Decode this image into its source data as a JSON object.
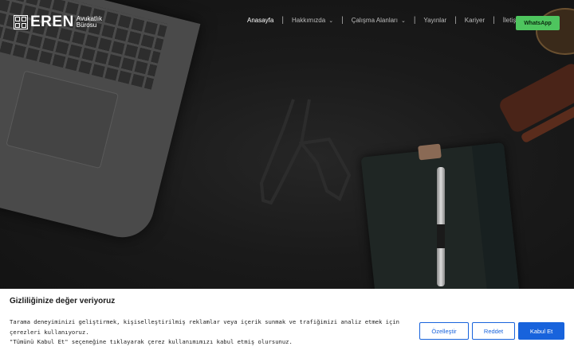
{
  "brand": {
    "name": "EREN",
    "subtitle_line1": "Avukatlık",
    "subtitle_line2": "Bürosu"
  },
  "nav": {
    "items": [
      {
        "label": "Anasayfa",
        "active": true,
        "dropdown": false
      },
      {
        "label": "Hakkımızda",
        "active": false,
        "dropdown": true
      },
      {
        "label": "Çalışma Alanları",
        "active": false,
        "dropdown": true
      },
      {
        "label": "Yayınlar",
        "active": false,
        "dropdown": false
      },
      {
        "label": "Kariyer",
        "active": false,
        "dropdown": false
      },
      {
        "label": "İletişim",
        "active": false,
        "dropdown": false
      }
    ],
    "whatsapp_label": "WhatsApp"
  },
  "cookie": {
    "title": "Gizliliğinize değer veriyoruz",
    "line1": "Tarama deneyiminizi geliştirmek, kişiselleştirilmiş reklamlar veya içerik sunmak ve trafiğimizi analiz etmek için",
    "line2": "çerezleri kullanıyoruz.",
    "line3": "\"Tümünü Kabul Et\" seçeneğine tıklayarak çerez kullanımımızı kabul etmiş olursunuz.",
    "customize_label": "Özelleştir",
    "reject_label": "Reddet",
    "accept_label": "Kabul Et"
  },
  "colors": {
    "accent": "#1863dc",
    "whatsapp": "#4ec55e",
    "background": "#161616"
  }
}
